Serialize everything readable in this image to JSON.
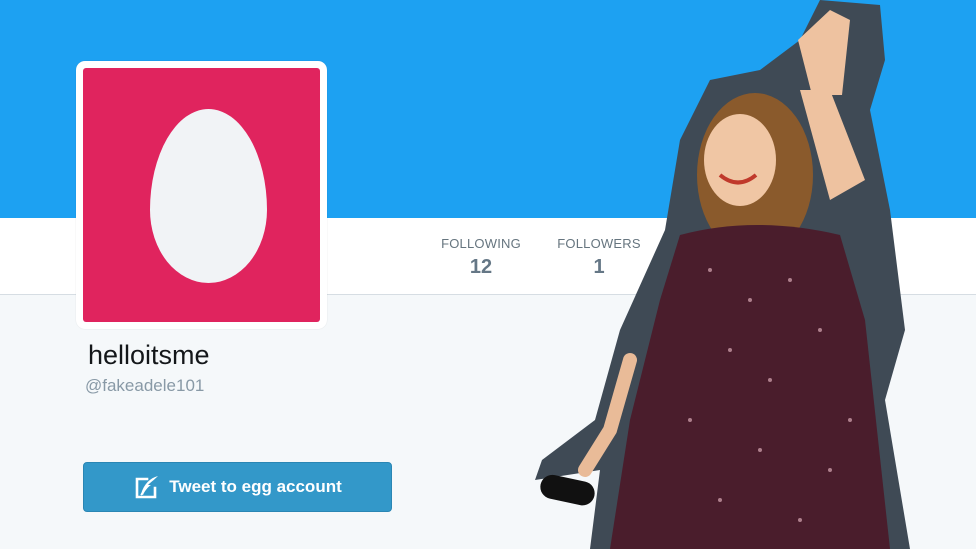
{
  "colors": {
    "banner": "#1da1f2",
    "avatar_background": "#e0245e",
    "egg": "#f1f3f6",
    "button": "#3398c9"
  },
  "profile": {
    "display_name": "helloitsme",
    "handle": "@fakeadele101",
    "avatar_icon": "egg-avatar-icon"
  },
  "stats": {
    "following_label": "FOLLOWING",
    "following_value": "12",
    "followers_label": "FOLLOWERS",
    "followers_value": "1"
  },
  "actions": {
    "tweet_button_label": "Tweet to egg account",
    "tweet_button_icon": "compose-quill-icon"
  },
  "photo": {
    "description_icon": "cutout-photo-of-singer-waving"
  }
}
